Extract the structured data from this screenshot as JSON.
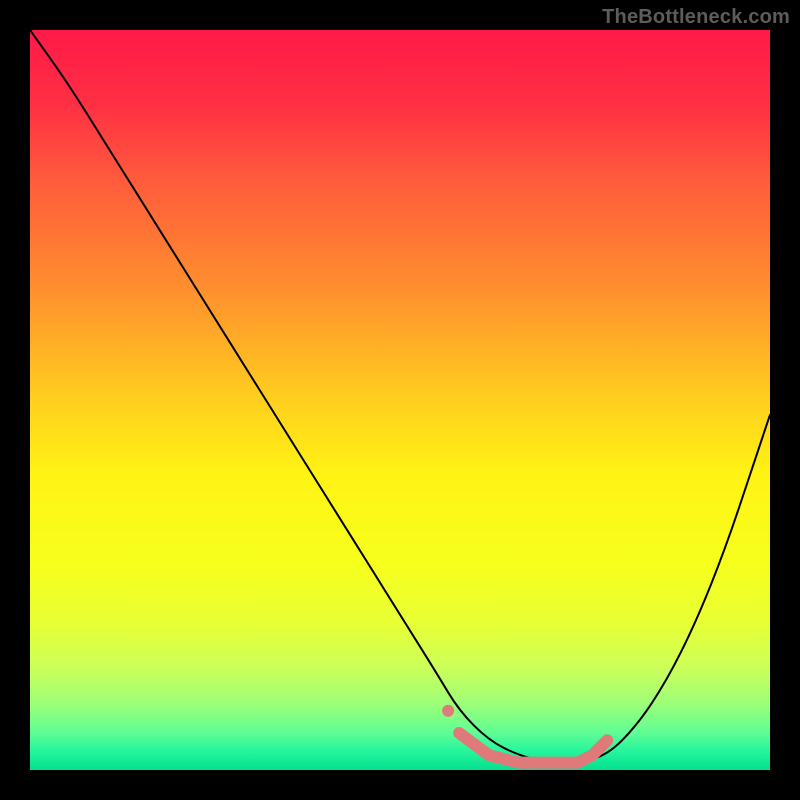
{
  "watermark": "TheBottleneck.com",
  "gradient": {
    "stops": [
      {
        "offset": 0.0,
        "color": "#ff1a48"
      },
      {
        "offset": 0.1,
        "color": "#ff2f44"
      },
      {
        "offset": 0.2,
        "color": "#ff5a3c"
      },
      {
        "offset": 0.35,
        "color": "#ff8f2e"
      },
      {
        "offset": 0.5,
        "color": "#ffcf1e"
      },
      {
        "offset": 0.6,
        "color": "#fff314"
      },
      {
        "offset": 0.72,
        "color": "#f7ff1c"
      },
      {
        "offset": 0.8,
        "color": "#e8ff35"
      },
      {
        "offset": 0.86,
        "color": "#cdff58"
      },
      {
        "offset": 0.91,
        "color": "#9dff78"
      },
      {
        "offset": 0.95,
        "color": "#5efd94"
      },
      {
        "offset": 0.975,
        "color": "#24f59d"
      },
      {
        "offset": 1.0,
        "color": "#04e08f"
      }
    ]
  },
  "chart_data": {
    "type": "line",
    "title": "",
    "xlabel": "",
    "ylabel": "",
    "xlim": [
      0,
      100
    ],
    "ylim": [
      0,
      100
    ],
    "series": [
      {
        "name": "bottleneck-curve",
        "x": [
          0,
          5,
          10,
          15,
          20,
          25,
          30,
          35,
          40,
          45,
          50,
          55,
          58,
          62,
          66,
          70,
          74,
          78,
          82,
          86,
          90,
          94,
          98,
          100
        ],
        "y": [
          100,
          93,
          85,
          77,
          69,
          61,
          53,
          45,
          37,
          29,
          21,
          13,
          8,
          4,
          2,
          1,
          1,
          2,
          6,
          12,
          20,
          30,
          42,
          48
        ]
      }
    ],
    "highlight": {
      "name": "sweet-spot-band",
      "color": "#e07a7a",
      "points": [
        {
          "x": 58,
          "y": 5
        },
        {
          "x": 62,
          "y": 2
        },
        {
          "x": 66,
          "y": 1
        },
        {
          "x": 70,
          "y": 1
        },
        {
          "x": 74,
          "y": 1
        },
        {
          "x": 76,
          "y": 2
        },
        {
          "x": 78,
          "y": 4
        }
      ]
    }
  }
}
